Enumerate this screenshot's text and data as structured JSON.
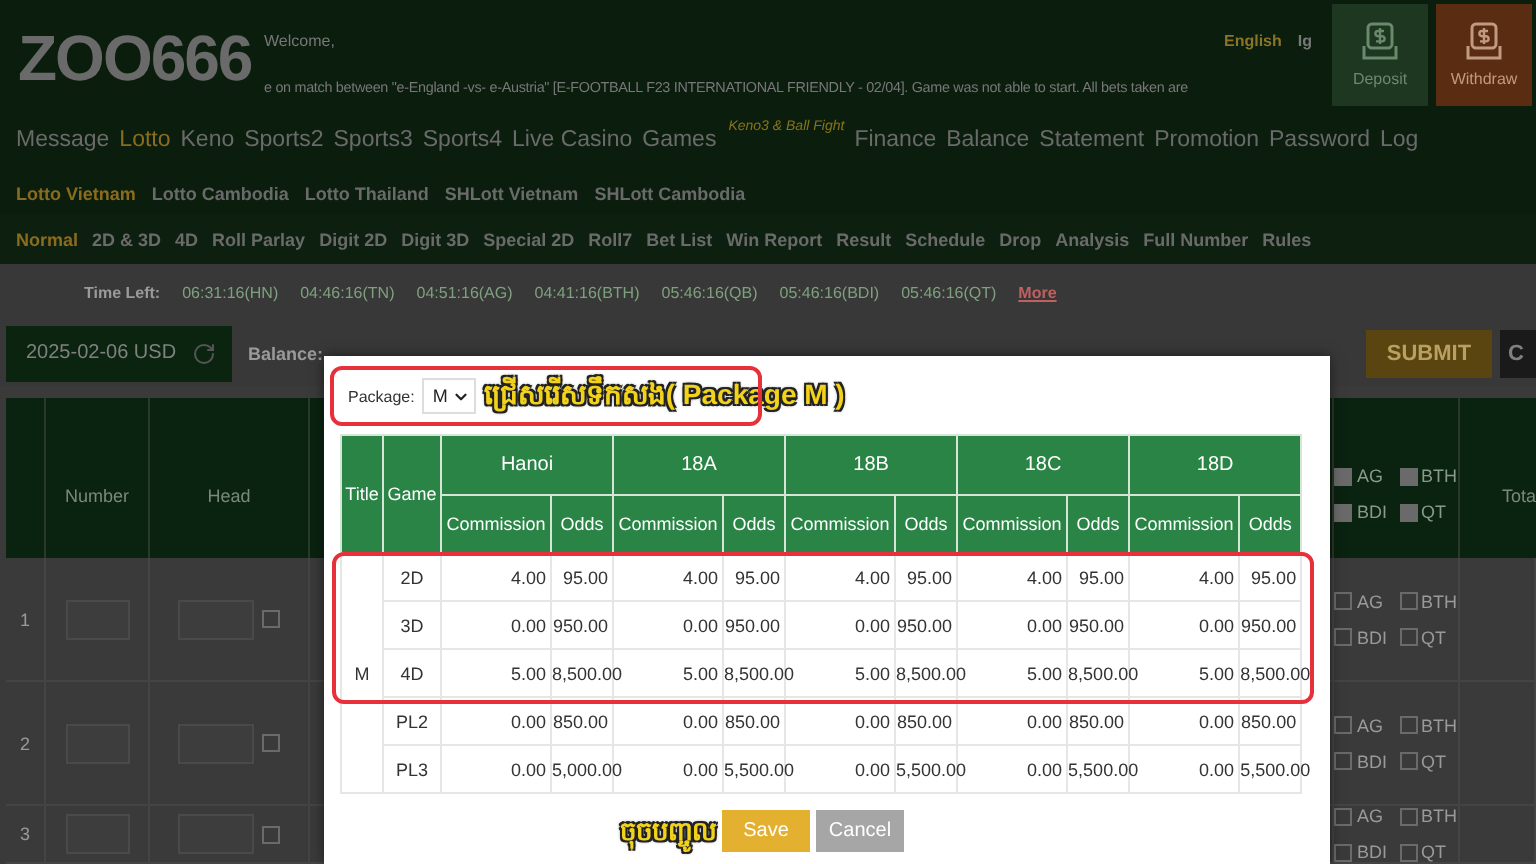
{
  "header": {
    "logo": "ZOO666",
    "welcome": "Welcome,",
    "ticker": "e on match between \"e-England -vs- e-Austria\" [E-FOOTBALL F23 INTERNATIONAL FRIENDLY - 02/04]. Game was not able to start. All bets taken are",
    "language": "English",
    "language_2": "Ig",
    "buttons": [
      {
        "label": "Deposit",
        "kind": "deposit"
      },
      {
        "label": "Withdraw",
        "kind": "withdraw"
      }
    ]
  },
  "main_nav": [
    {
      "label": "Message",
      "selected": false
    },
    {
      "label": "Lotto",
      "selected": true
    },
    {
      "label": "Keno",
      "selected": false
    },
    {
      "label": "Sports2",
      "selected": false
    },
    {
      "label": "Sports3",
      "selected": false
    },
    {
      "label": "Sports4",
      "selected": false
    },
    {
      "label": "Live Casino",
      "selected": false
    },
    {
      "label": "Games",
      "selected": false,
      "badge": "Keno3 & Ball Fight"
    },
    {
      "label": "Finance",
      "selected": false
    },
    {
      "label": "Balance",
      "selected": false
    },
    {
      "label": "Statement",
      "selected": false
    },
    {
      "label": "Promotion",
      "selected": false
    },
    {
      "label": "Password",
      "selected": false
    },
    {
      "label": "Log",
      "selected": false
    }
  ],
  "lotto_tabs": [
    {
      "label": "Lotto Vietnam",
      "selected": true
    },
    {
      "label": "Lotto Cambodia",
      "selected": false
    },
    {
      "label": "Lotto Thailand",
      "selected": false
    },
    {
      "label": "SHLott Vietnam",
      "selected": false
    },
    {
      "label": "SHLott Cambodia",
      "selected": false
    }
  ],
  "bet_tabs": [
    {
      "label": "Normal",
      "selected": true
    },
    {
      "label": "2D & 3D",
      "selected": false
    },
    {
      "label": "4D",
      "selected": false
    },
    {
      "label": "Roll Parlay",
      "selected": false
    },
    {
      "label": "Digit 2D",
      "selected": false
    },
    {
      "label": "Digit 3D",
      "selected": false
    },
    {
      "label": "Special 2D",
      "selected": false
    },
    {
      "label": "Roll7",
      "selected": false
    },
    {
      "label": "Bet List",
      "selected": false
    },
    {
      "label": "Win Report",
      "selected": false
    },
    {
      "label": "Result",
      "selected": false
    },
    {
      "label": "Schedule",
      "selected": false
    },
    {
      "label": "Drop",
      "selected": false
    },
    {
      "label": "Analysis",
      "selected": false
    },
    {
      "label": "Full Number",
      "selected": false
    },
    {
      "label": "Rules",
      "selected": false
    }
  ],
  "time_left": {
    "label": "Time Left:",
    "items": [
      "06:31:16(HN)",
      "04:46:16(TN)",
      "04:51:16(AG)",
      "04:41:16(BTH)",
      "05:46:16(QB)",
      "05:46:16(BDI)",
      "05:46:16(QT)"
    ],
    "more": "More"
  },
  "toolbar": {
    "date": "2025-02-06 USD",
    "balance_label": "Balance:",
    "submit": "SUBMIT",
    "button_2": "C"
  },
  "bet_table": {
    "columns": [
      "Number",
      "Head"
    ],
    "total": "Tota",
    "header_regions": [
      {
        "label": "AG",
        "checked": true
      },
      {
        "label": "BTH",
        "checked": true
      },
      {
        "label": "BDI",
        "checked": true
      },
      {
        "label": "QT",
        "checked": true
      }
    ],
    "rows": [
      {
        "index": "1",
        "head_checked": false,
        "regions": [
          {
            "label": "AG",
            "checked": false
          },
          {
            "label": "BTH",
            "checked": false
          },
          {
            "label": "BDI",
            "checked": false
          },
          {
            "label": "QT",
            "checked": false
          }
        ]
      },
      {
        "index": "2",
        "head_checked": false,
        "regions": [
          {
            "label": "AG",
            "checked": false
          },
          {
            "label": "BTH",
            "checked": false
          },
          {
            "label": "BDI",
            "checked": false
          },
          {
            "label": "QT",
            "checked": false
          }
        ]
      },
      {
        "index": "3",
        "head_checked": false,
        "regions": [
          {
            "label": "AG",
            "checked": false
          },
          {
            "label": "BTH",
            "checked": false
          },
          {
            "label": "BDI",
            "checked": false
          },
          {
            "label": "QT",
            "checked": false
          }
        ]
      }
    ]
  },
  "modal": {
    "package_label": "Package:",
    "package_value": "M",
    "annotation": "ជ្រើសរើសទឹកសង( Package M )",
    "title_header": "Title",
    "game_header": "Game",
    "title_value": "M",
    "groups": [
      {
        "name": "Hanoi",
        "sub": [
          "Commission",
          "Odds"
        ]
      },
      {
        "name": "18A",
        "sub": [
          "Commission",
          "Odds"
        ]
      },
      {
        "name": "18B",
        "sub": [
          "Commission",
          "Odds"
        ]
      },
      {
        "name": "18C",
        "sub": [
          "Commission",
          "Odds"
        ]
      },
      {
        "name": "18D",
        "sub": [
          "Commission",
          "Odds"
        ]
      }
    ],
    "rows": [
      {
        "game": "2D",
        "values": [
          "4.00",
          "95.00",
          "4.00",
          "95.00",
          "4.00",
          "95.00",
          "4.00",
          "95.00",
          "4.00",
          "95.00"
        ]
      },
      {
        "game": "3D",
        "values": [
          "0.00",
          "950.00",
          "0.00",
          "950.00",
          "0.00",
          "950.00",
          "0.00",
          "950.00",
          "0.00",
          "950.00"
        ]
      },
      {
        "game": "4D",
        "values": [
          "5.00",
          "8,500.00",
          "5.00",
          "8,500.00",
          "5.00",
          "8,500.00",
          "5.00",
          "8,500.00",
          "5.00",
          "8,500.00"
        ]
      },
      {
        "game": "PL2",
        "values": [
          "0.00",
          "850.00",
          "0.00",
          "850.00",
          "0.00",
          "850.00",
          "0.00",
          "850.00",
          "0.00",
          "850.00"
        ]
      },
      {
        "game": "PL3",
        "values": [
          "0.00",
          "5,000.00",
          "0.00",
          "5,500.00",
          "0.00",
          "5,500.00",
          "0.00",
          "5,500.00",
          "0.00",
          "5,500.00"
        ]
      }
    ],
    "save_hint": "ចុចបញ្ចូល",
    "buttons": [
      {
        "label": "Save",
        "kind": "primary"
      },
      {
        "label": "Cancel",
        "kind": "secondary"
      }
    ]
  }
}
